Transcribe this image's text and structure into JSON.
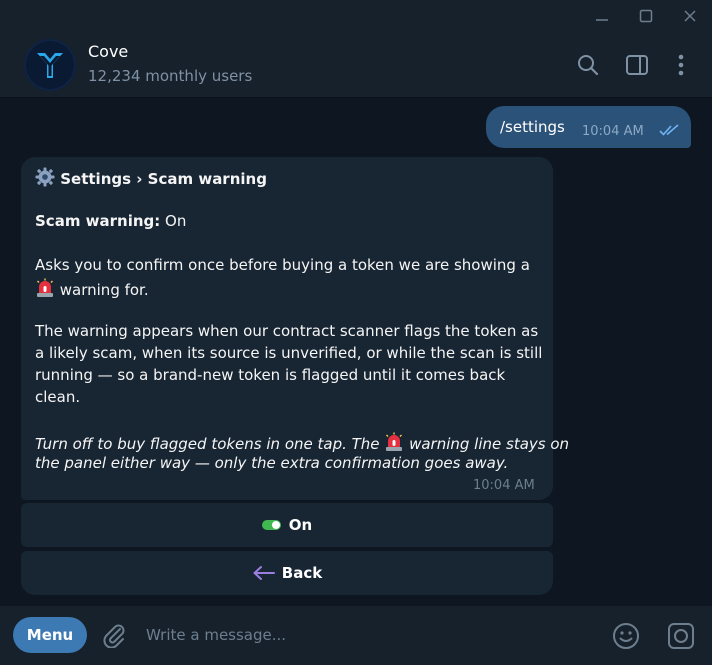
{
  "window": {
    "minimize_icon": "minimize-icon",
    "maximize_icon": "maximize-icon",
    "close_icon": "close-icon"
  },
  "header": {
    "title": "Cove",
    "subtitle": "12,234 monthly users",
    "icons": [
      "search-icon",
      "sidebar-toggle-icon",
      "more-vertical-icon"
    ]
  },
  "outgoing": {
    "text": "/settings",
    "time": "10:04 AM"
  },
  "incoming": {
    "heading": "Settings › Scam warning",
    "status_label": "Scam warning:",
    "status_value": " On",
    "para1_line1": "Asks you to confirm once before buying a token we are showing a",
    "para1_line2": " warning for.",
    "para2_line1": "The warning appears when our contract scanner flags the token as",
    "para2_line2": "a likely scam, when its source is unverified, or while the scan is still",
    "para2_line3": "running — so a brand-new token is flagged until it comes back",
    "para2_line4": "clean.",
    "para3_line1_a": "Turn off to buy flagged tokens in one tap. The ",
    "para3_line1_b": " warning line stays on",
    "para3_line2": "the panel either way — only the extra confirmation goes away.",
    "time": "10:04 AM"
  },
  "keyboard": {
    "toggle_label": "On",
    "back_label": "Back"
  },
  "composer": {
    "menu_label": "Menu",
    "placeholder": "Write a message..."
  },
  "colors": {
    "background": "#0e1621",
    "panel": "#17212b",
    "incoming_bubble": "#182533",
    "outgoing_bubble": "#2b5278",
    "accent": "#3d79b2",
    "toggle_on": "#3fb950"
  }
}
